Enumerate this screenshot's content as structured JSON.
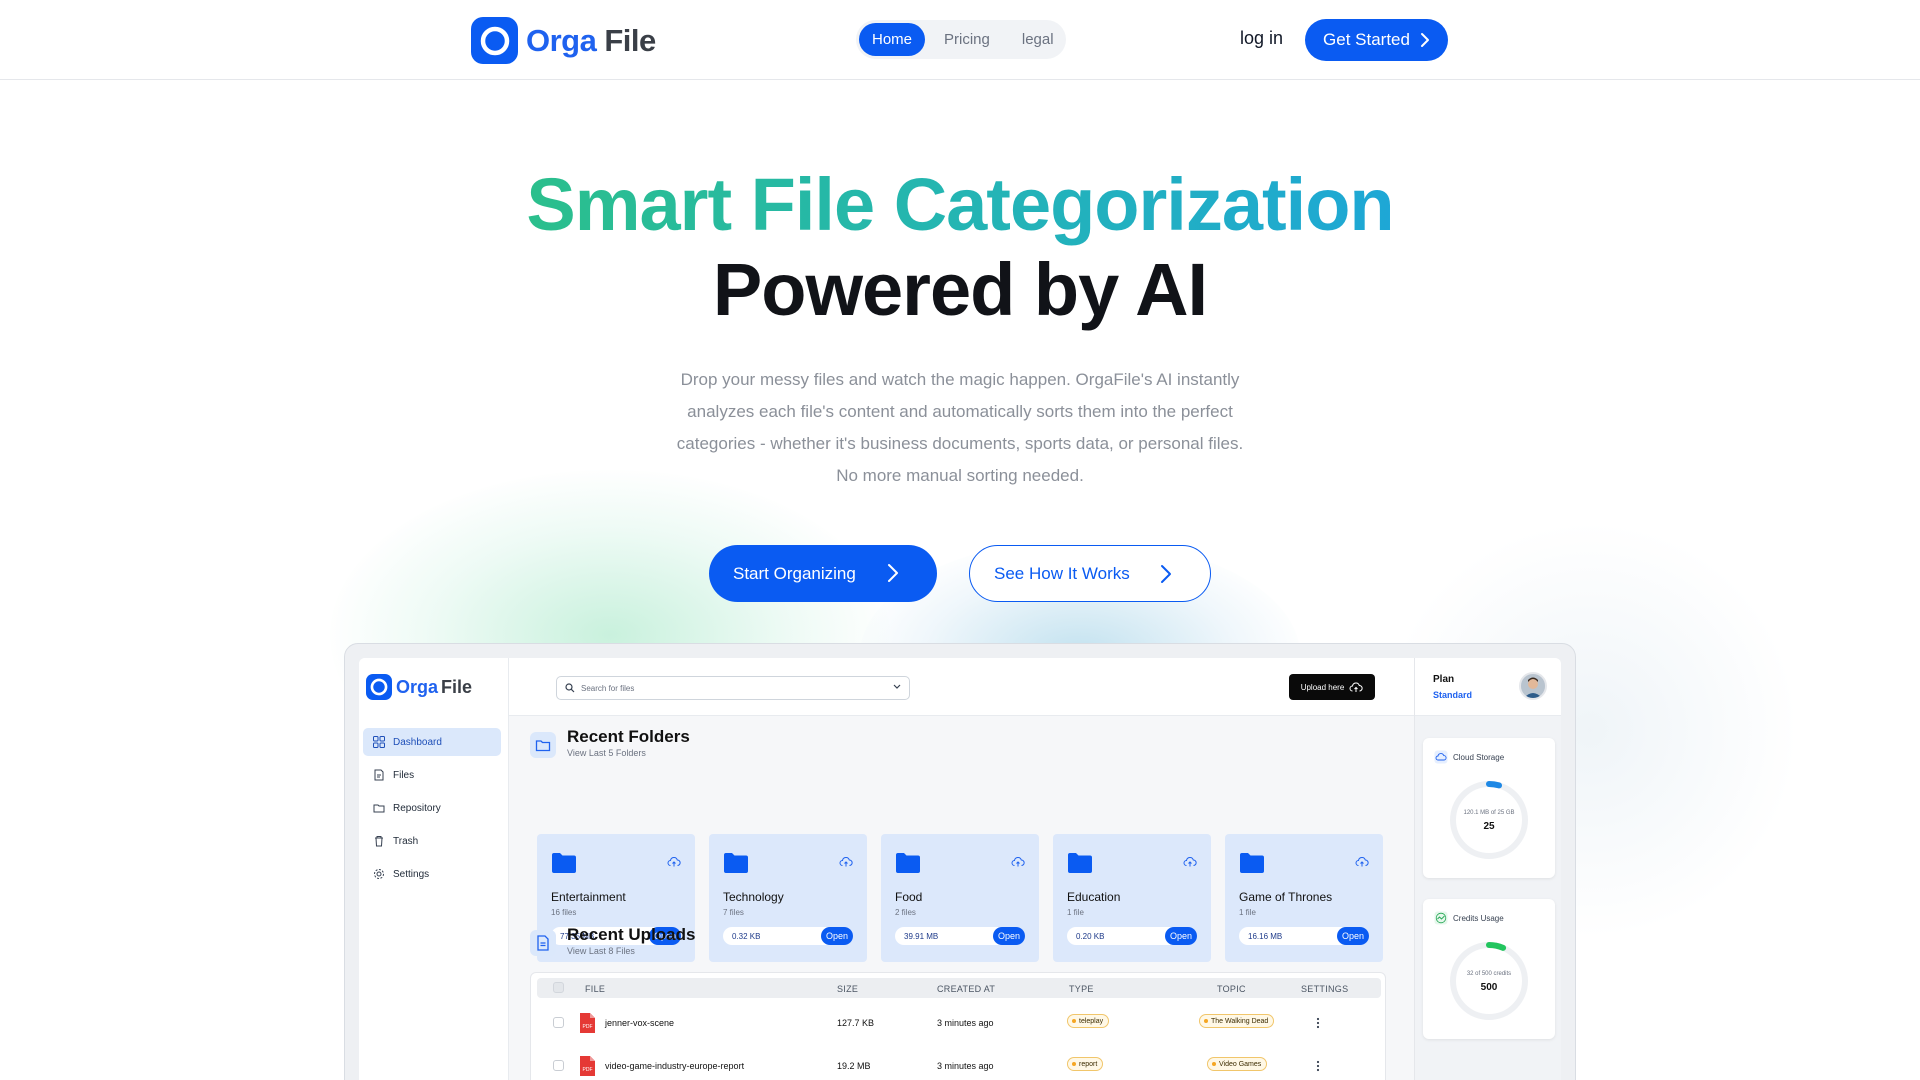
{
  "header": {
    "brand_part1": "Orga",
    "brand_part2": "File",
    "nav": [
      "Home",
      "Pricing",
      "legal"
    ],
    "login": "log in",
    "cta": "Get Started"
  },
  "hero": {
    "title_line1": "Smart File Categorization",
    "title_line2": "Powered by AI",
    "subtitle_lines": [
      "Drop your messy files and watch the magic happen. OrgaFile's AI instantly",
      "analyzes each file's content and automatically sorts them into the perfect",
      "categories - whether it's business documents, sports data, or personal files.",
      "No more manual sorting needed."
    ],
    "primary_button": "Start Organizing",
    "secondary_button": "See How It Works"
  },
  "preview": {
    "brand_part1": "Orga",
    "brand_part2": "File",
    "sidebar": [
      "Dashboard",
      "Files",
      "Repository",
      "Trash",
      "Settings"
    ],
    "search_placeholder": "Search for files",
    "upload_label": "Upload here",
    "plan_label": "Plan",
    "plan_value": "Standard",
    "recent_folders": {
      "title": "Recent Folders",
      "subtitle": "View Last 5 Folders",
      "open_label": "Open",
      "items": [
        {
          "name": "Entertainment",
          "count": "16 files",
          "size": "77.35 MB"
        },
        {
          "name": "Technology",
          "count": "7 files",
          "size": "0.32 KB"
        },
        {
          "name": "Food",
          "count": "2 files",
          "size": "39.91 MB"
        },
        {
          "name": "Education",
          "count": "1 file",
          "size": "0.20 KB"
        },
        {
          "name": "Game of Thrones",
          "count": "1 file",
          "size": "16.16 MB"
        }
      ]
    },
    "recent_uploads": {
      "title": "Recent Uploads",
      "subtitle": "View Last 8 Files",
      "columns": [
        "FILE",
        "SIZE",
        "CREATED AT",
        "TYPE",
        "TOPIC",
        "SETTINGS"
      ],
      "rows": [
        {
          "file": "jenner-vox-scene",
          "size": "127.7 KB",
          "created": "3 minutes ago",
          "type": "teleplay",
          "topic": "The Walking Dead"
        },
        {
          "file": "video-game-industry-europe-report",
          "size": "19.2 MB",
          "created": "3 minutes ago",
          "type": "report",
          "topic": "Video Games"
        }
      ]
    },
    "cloud_storage": {
      "title": "Cloud Storage",
      "detail": "120.1 MB of 25 GB",
      "value": "25",
      "fraction": 0.005
    },
    "credits_usage": {
      "title": "Credits Usage",
      "detail": "32 of 500 credits",
      "value": "500",
      "fraction": 0.064
    },
    "colors": {
      "accent": "#0a5bf2",
      "folder_bg": "#dce8fb",
      "tag_border": "#f1c66b"
    }
  }
}
